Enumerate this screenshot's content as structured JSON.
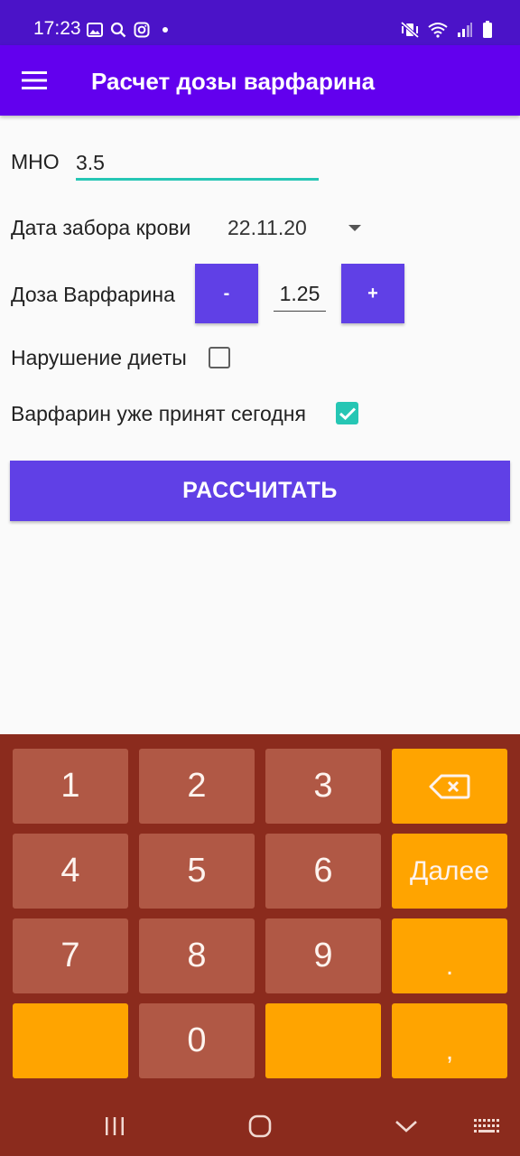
{
  "status_bar": {
    "time": "17:23",
    "left_icons": [
      "image-icon",
      "search-icon",
      "instagram-icon",
      "dot-icon"
    ],
    "right_icons": [
      "mute-vibrate-icon",
      "wifi-icon",
      "signal-icon",
      "battery-icon"
    ]
  },
  "app_bar": {
    "title": "Расчет дозы варфарина",
    "menu_icon": "hamburger-menu-icon"
  },
  "form": {
    "inr_label": "МНО",
    "inr_value": "3.5",
    "date_label": "Дата забора крови",
    "date_value": "22.11.20",
    "dose_label": "Доза Варфарина",
    "dose_minus_label": "-",
    "dose_value": "1.25",
    "dose_plus_label": "+",
    "diet_label": "Нарушение диеты",
    "diet_checked": false,
    "taken_label": "Варфарин уже принят сегодня",
    "taken_checked": true,
    "calculate_label": "РАССЧИТАТЬ"
  },
  "keyboard": {
    "keys": [
      "1",
      "2",
      "3",
      "4",
      "5",
      "6",
      "7",
      "8",
      "9",
      "0"
    ],
    "next_label": "Далее",
    "dot_label": ".",
    "comma_label": ","
  },
  "colors": {
    "status_bar": "#4b13c8",
    "app_bar": "#6200ee",
    "button": "#6040e6",
    "accent": "#26c6b4",
    "keyboard_bg": "#8b2b1d",
    "key_number": "#b05845",
    "key_action": "#ffa400"
  }
}
